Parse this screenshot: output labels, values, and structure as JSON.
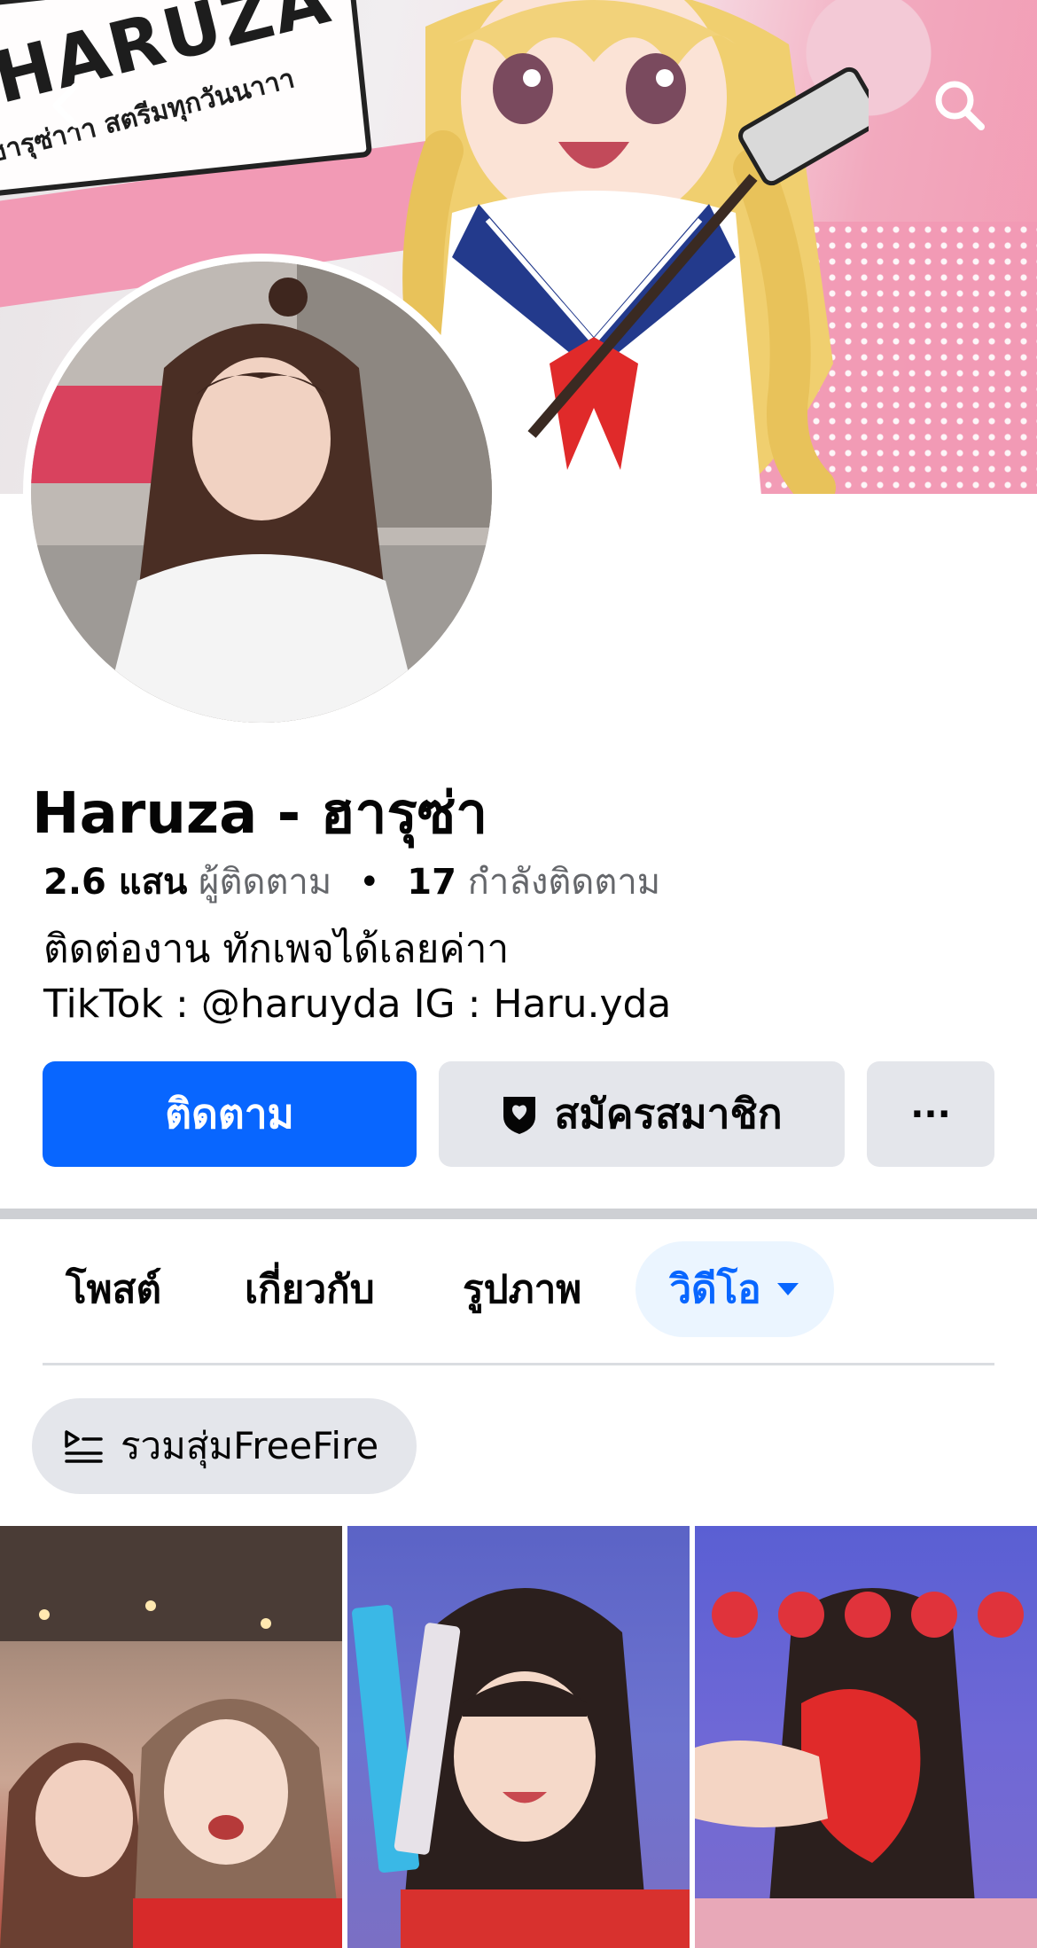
{
  "cover": {
    "speech_title": "HARUZA",
    "speech_subtitle": "ฮารุซ่าาา สตรีมทุกวันนาาา",
    "back_icon": "chevron-left-icon",
    "search_icon": "search-icon"
  },
  "profile": {
    "name": "Haruza - ฮารุซ่า",
    "followers_count": "2.6 แสน",
    "followers_label": "ผู้ติดตาม",
    "separator": "•",
    "following_count": "17",
    "following_label": "กำลังติดตาม",
    "bio_line1": "ติดต่องาน ทักเพจได้เลยค่าา",
    "bio_line2": "TikTok : @haruyda IG : Haru.yda"
  },
  "actions": {
    "follow_label": "ติดตาม",
    "subscribe_label": "สมัครสมาชิก",
    "subscribe_icon": "shield-heart-icon",
    "more_label": "···"
  },
  "tabs": [
    {
      "label": "โพสต์",
      "active": false
    },
    {
      "label": "เกี่ยวกับ",
      "active": false
    },
    {
      "label": "รูปภาพ",
      "active": false
    },
    {
      "label": "วิดีโอ",
      "active": true
    }
  ],
  "playlist_chip": {
    "label": "รวมสุ่มFreeFire",
    "icon": "playlist-icon"
  },
  "colors": {
    "accent": "#0866ff",
    "button_gray": "#e4e6eb",
    "muted_text": "#65676b",
    "active_tab_bg": "#ebf5ff"
  },
  "videos": [
    {
      "name": "video-thumbnail-1"
    },
    {
      "name": "video-thumbnail-2"
    },
    {
      "name": "video-thumbnail-3"
    }
  ]
}
